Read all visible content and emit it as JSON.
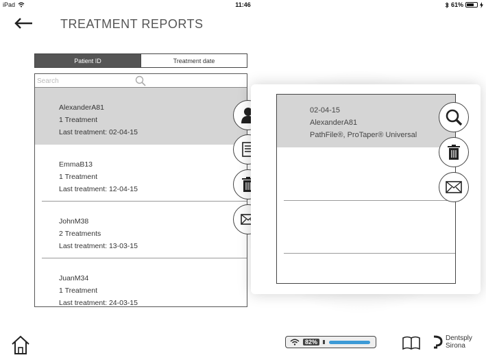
{
  "status_bar": {
    "device": "iPad",
    "time": "11:46",
    "battery": "61%"
  },
  "header": {
    "title": "TREATMENT REPORTS"
  },
  "segment": {
    "patient_id": "Patient ID",
    "treatment_date": "Treatment date"
  },
  "search": {
    "placeholder": "Search"
  },
  "patients": [
    {
      "name": "AlexanderA81",
      "count": "1 Treatment",
      "last": "Last treatment:  02-04-15"
    },
    {
      "name": "EmmaB13",
      "count": "1 Treatment",
      "last": "Last treatment:  12-04-15"
    },
    {
      "name": "JohnM38",
      "count": "2 Treatments",
      "last": "Last treatment:  13-03-15"
    },
    {
      "name": "JuanM34",
      "count": "1 Treatment",
      "last": "Last treatment:  24-03-15"
    }
  ],
  "detail": {
    "date": "02-04-15",
    "patient": "AlexanderA81",
    "files": "PathFile®, ProTaper® Universal"
  },
  "bottom": {
    "device_battery": "82%",
    "brand_line1": "Dentsply",
    "brand_line2": "Sirona"
  },
  "colors": {
    "selected_row": "#d5d5d5",
    "active_segment": "#555555",
    "tool_accent": "#3c9ad6"
  }
}
